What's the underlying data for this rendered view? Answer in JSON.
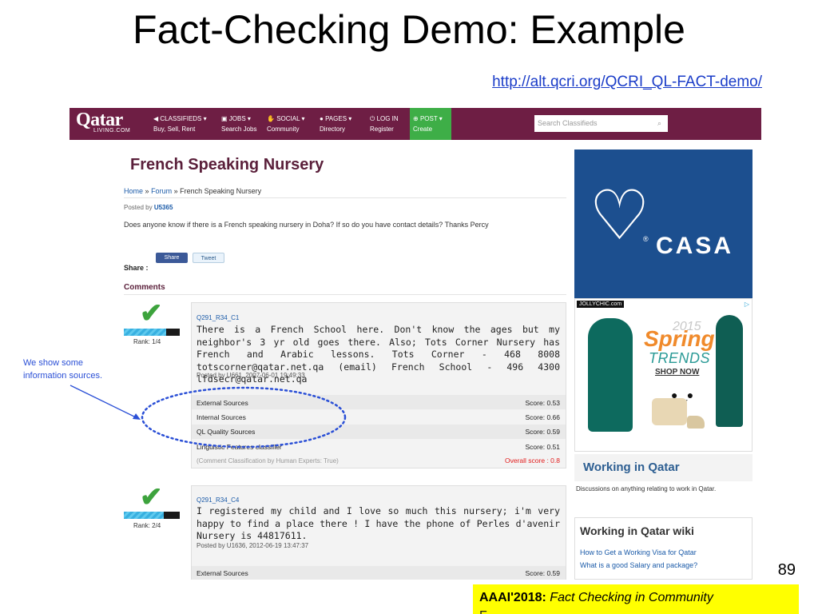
{
  "slide": {
    "title": "Fact-Checking Demo: Example",
    "link": "http://alt.qcri.org/QCRI_QL-FACT-demo/",
    "page_number": "89",
    "footer_bold": "AAAI'2018:",
    "footer_italic": "Fact Checking in Community",
    "footer_overflow": "F",
    "annotation": "We show some information sources."
  },
  "nav": {
    "logo": "Qatar",
    "logo_sub": "LIVING.COM",
    "items": [
      {
        "top": "CLASSIFIEDS ▾",
        "bottom": "Buy, Sell, Rent"
      },
      {
        "top": "JOBS ▾",
        "bottom": "Search Jobs"
      },
      {
        "top": "SOCIAL ▾",
        "bottom": "Community"
      },
      {
        "top": "PAGES ▾",
        "bottom": "Directory"
      },
      {
        "top": "LOG IN",
        "bottom": "Register"
      },
      {
        "top": "POST ▾",
        "bottom": "Create"
      }
    ],
    "search_placeholder": "Search Classifieds"
  },
  "post": {
    "title": "French Speaking Nursery",
    "breadcrumb": [
      "Home",
      "»",
      "Forum",
      "»",
      "French Speaking Nursery"
    ],
    "posted_by_label": "Posted by",
    "posted_by_user": "U5365",
    "question": "Does anyone know if there is a French speaking nursery in Doha? If so do you have contact details? Thanks Percy",
    "share_button": "Share",
    "tweet_button": "Tweet",
    "share_label": "Share :",
    "comments_header": "Comments"
  },
  "comments": [
    {
      "id": "Q291_R34_C1",
      "rank": "Rank: 1/4",
      "rank_fraction": 0.75,
      "text": "There is a French School here. Don't know the ages but my neighbor's 3 yr old goes there. Also; Tots Corner Nursery has French and Arabic lessons. Tots Corner - 468 8008 totscorner@qatar.net.qa (email) French School - 496 4300 lfdsecr@qatar.net.qa",
      "posted": "Posted by U661, 2007-06-01 19:49:33",
      "scores": [
        {
          "label": "External Sources",
          "value": "Score: 0.53"
        },
        {
          "label": "Internal Sources",
          "value": "Score: 0.66"
        },
        {
          "label": "QL Quality Sources",
          "value": "Score: 0.59"
        },
        {
          "label": "Linguistic Features classifier",
          "value": "Score: 0.51"
        }
      ],
      "human": "(Comment Classification by Human Experts: True)",
      "overall": "Overall score : 0.8"
    },
    {
      "id": "Q291_R34_C4",
      "rank": "Rank: 2/4",
      "rank_fraction": 0.72,
      "text": "I registered my child and I love so much this nursery; i'm very happy to find a place there ! I have the phone of Perles d'avenir Nursery is 44817611.",
      "posted": "Posted by U1636, 2012-06-19 13:47:37",
      "scores": [
        {
          "label": "External Sources",
          "value": "Score: 0.59"
        }
      ]
    }
  ],
  "sidebar": {
    "casa_text": "CASA",
    "jolly_tag": "JOLLYCHIC.com",
    "ad_year": "2015",
    "ad_spring": "Spring",
    "ad_trends": "TRENDS",
    "ad_shop": "SHOP NOW",
    "wiq_title": "Working in Qatar",
    "wiq_desc": "Discussions on anything relating to work in Qatar.",
    "wiki_title": "Working in Qatar wiki",
    "wiki_links": [
      "How to Get a Working Visa for Qatar",
      "What is a good Salary and package?"
    ]
  },
  "colors": {
    "nav_bg": "#6e1e44",
    "post_green": "#3eae47",
    "title_maroon": "#5a1f3a",
    "link_blue": "#1a5aa8",
    "annotation_blue": "#2a4fd6",
    "overall_red": "#e21c1c",
    "footer_yellow": "#ffff00"
  }
}
